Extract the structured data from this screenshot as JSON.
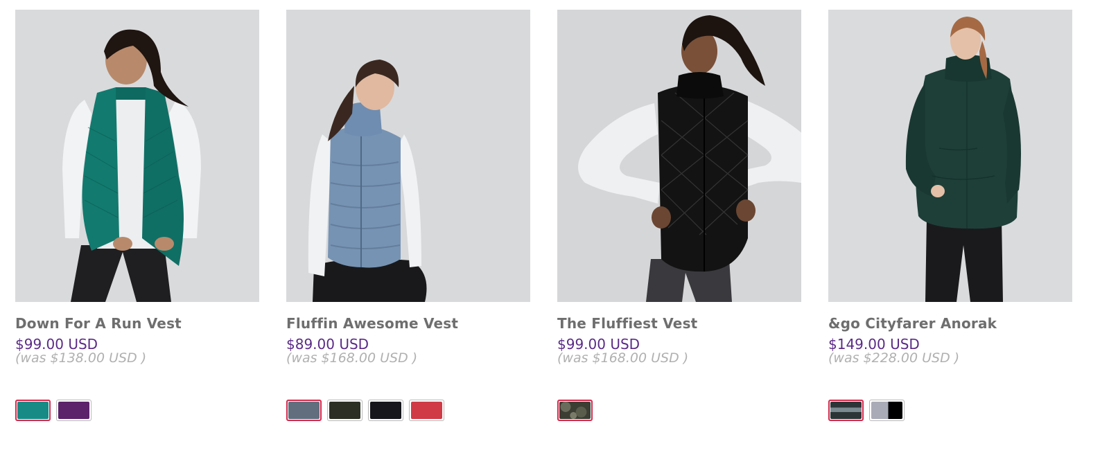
{
  "products": [
    {
      "name": "Down For A Run Vest",
      "price": "$99.00 USD",
      "was": "(was $138.00 USD )",
      "swatches": [
        {
          "color": "#178a86",
          "selected": true
        },
        {
          "color": "#5c226a",
          "selected": false
        }
      ]
    },
    {
      "name": "Fluffin Awesome Vest",
      "price": "$89.00 USD",
      "was": "(was $168.00 USD )",
      "swatches": [
        {
          "color": "#626e7d",
          "selected": true
        },
        {
          "color": "#2c2f24",
          "selected": false
        },
        {
          "color": "#16161c",
          "selected": false
        },
        {
          "color": "#cf3a46",
          "selected": false
        }
      ]
    },
    {
      "name": "The Fluffiest Vest",
      "price": "$99.00 USD",
      "was": "(was $168.00 USD )",
      "swatches": [
        {
          "color": "camo",
          "selected": true
        }
      ]
    },
    {
      "name": "&go Cityfarer Anorak",
      "price": "$149.00 USD",
      "was": "(was $228.00 USD )",
      "swatches": [
        {
          "color": "stripe-dark",
          "selected": true
        },
        {
          "color": "grey-black",
          "selected": false
        }
      ]
    }
  ],
  "colors": {
    "name_text": "#6e6e6e",
    "price_text": "#5b2a86",
    "was_text": "#b0b0b0",
    "selected_border": "#d5294c"
  }
}
